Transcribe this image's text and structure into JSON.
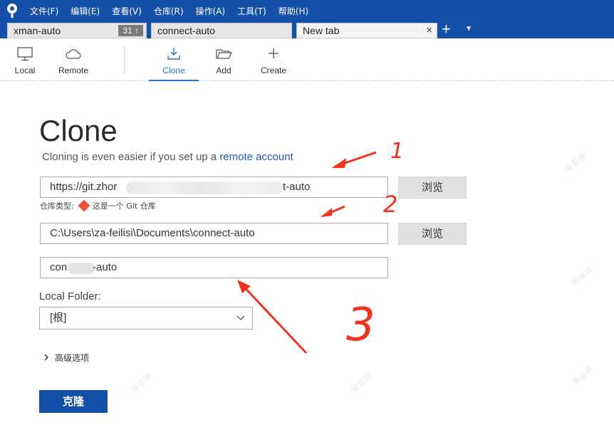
{
  "menubar": {
    "items": [
      "文件(F)",
      "编辑(E)",
      "查看(V)",
      "仓库(R)",
      "操作(A)",
      "工具(T)",
      "帮助(H)"
    ]
  },
  "tabs": [
    {
      "label": "xman-auto",
      "badge": "31 ↑"
    },
    {
      "label": "connect-auto"
    },
    {
      "label": "New tab",
      "close": "×"
    }
  ],
  "tab_new": "+",
  "toolbar": {
    "local": "Local",
    "remote": "Remote",
    "clone": "Clone",
    "add": "Add",
    "create": "Create"
  },
  "page": {
    "title": "Clone",
    "subtitle_prefix": "Cloning is even easier if you set up a ",
    "subtitle_link": "remote account"
  },
  "form": {
    "url_start": "https://git.zhor",
    "url_end": "t-auto",
    "browse1": "浏览",
    "repo_type_label": "仓库类型:",
    "repo_type_value": "这是一个 Git 仓库",
    "dest_path": "C:\\Users\\za-feilisi\\Documents\\connect-auto",
    "browse2": "浏览",
    "name_start": "con",
    "name_end": "-auto",
    "local_folder_label": "Local Folder:",
    "local_folder_value": "[根]",
    "advanced_label": "高级选项",
    "clone_button": "克隆"
  },
  "annotations": [
    "1",
    "2",
    "3"
  ],
  "colors": {
    "brand": "#1550a8",
    "accent": "#1e77d0",
    "annotation": "#f0331f"
  }
}
